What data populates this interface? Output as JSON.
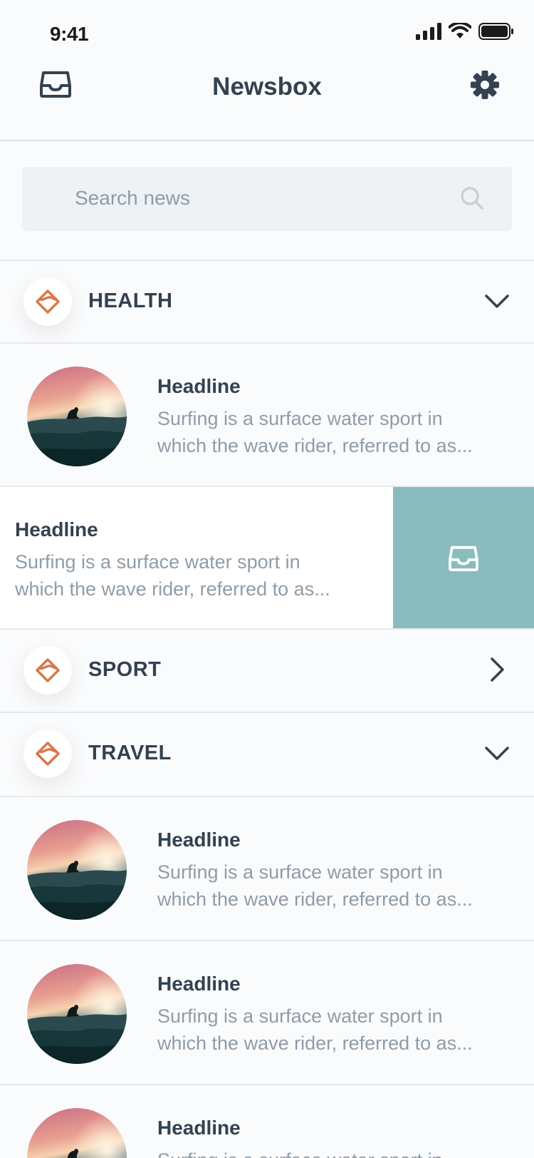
{
  "status": {
    "time": "9:41"
  },
  "header": {
    "title": "Newsbox"
  },
  "search": {
    "placeholder": "Search news"
  },
  "categories": [
    {
      "label": "HEALTH",
      "state": "expanded"
    },
    {
      "label": "SPORT",
      "state": "collapsed"
    },
    {
      "label": "TRAVEL",
      "state": "expanded"
    }
  ],
  "health_articles": [
    {
      "headline": "Headline",
      "snippet": "Surfing is a surface water sport in which the wave rider, referred to as..."
    },
    {
      "headline": "Headline",
      "snippet": "Surfing is a surface water sport in which the wave rider, referred to as..."
    }
  ],
  "travel_articles": [
    {
      "headline": "Headline",
      "snippet": "Surfing is a surface water sport in which the wave rider, referred to as..."
    },
    {
      "headline": "Headline",
      "snippet": "Surfing is a surface water sport in which the wave rider, referred to as..."
    },
    {
      "headline": "Headline",
      "snippet": "Surfing is a surface water sport in which the wave rider, referred to as..."
    }
  ],
  "icons": {
    "nav_left": "inbox-icon",
    "nav_right": "gear-icon",
    "search": "search-icon",
    "category": "diamond-logo-icon",
    "expanded": "chevron-down-icon",
    "collapsed": "chevron-right-icon",
    "swipe_action": "archive-icon"
  },
  "colors": {
    "text_dark": "#334150",
    "text_muted": "#8f9ca8",
    "accent_orange": "#d9784a",
    "archive_teal": "#8abbbd",
    "search_bg": "#eff2f4"
  }
}
